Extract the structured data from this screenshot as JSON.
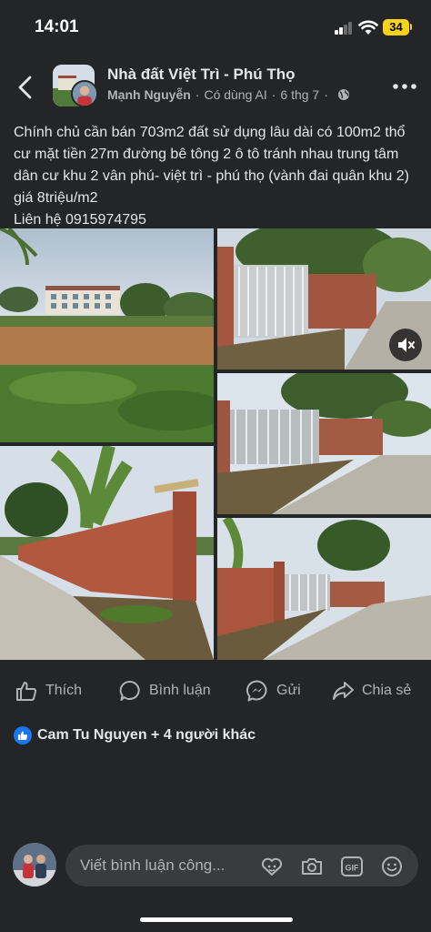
{
  "status_bar": {
    "time": "14:01",
    "battery": "34"
  },
  "header": {
    "group_name": "Nhà đất Việt Trì - Phú Thọ",
    "author": "Mạnh Nguyễn",
    "separator": "·",
    "ai_label": "Có dùng AI",
    "date": "6 thg 7",
    "icons": [
      "back-icon",
      "globe-icon",
      "more-icon"
    ]
  },
  "post": {
    "text": "Chính chủ cần bán 703m2 đất sử dụng lâu dài có 100m2 thổ cư mặt tiền 27m đường bê tông 2 ô tô tránh nhau trung tâm dân cư khu 2 vân phú- việt trì - phú thọ (vành đai quân khu 2) giá 8triệu/m2\nLiên hệ 0915974795"
  },
  "actions": {
    "like": "Thích",
    "comment": "Bình luận",
    "send": "Gửi",
    "share": "Chia sẻ"
  },
  "reactions": {
    "text": "Cam Tu Nguyen + 4 người khác"
  },
  "comment_box": {
    "placeholder": "Viết bình luận công...",
    "gif_label": "GIF"
  },
  "colors": {
    "background": "#242526",
    "text": "#e4e6eb",
    "secondary": "#b0b3b8",
    "like_blue": "#1877f2",
    "battery": "#f6d21a"
  }
}
